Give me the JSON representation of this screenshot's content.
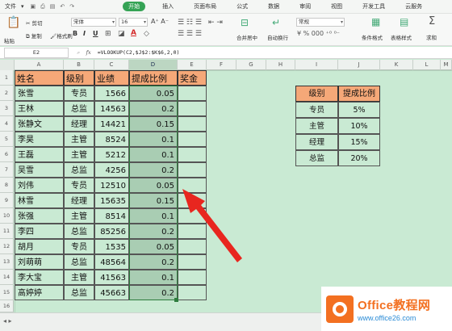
{
  "menu": {
    "file": "文件",
    "tabs": [
      "开始",
      "插入",
      "页面布局",
      "公式",
      "数据",
      "审阅",
      "视图",
      "开发工具",
      "云服务"
    ],
    "active_tab": "开始"
  },
  "ribbon": {
    "paste": "粘贴",
    "cut": "剪切",
    "copy": "复制",
    "format_painter": "格式刷",
    "font_name": "宋体",
    "font_size": "16",
    "merge_center": "合并居中",
    "auto_wrap": "自动换行",
    "number_format": "常规",
    "cond_format": "条件格式",
    "table_style": "表格样式",
    "sum": "求和",
    "font_buttons": [
      "B",
      "I",
      "U"
    ],
    "font_color_letter": "A",
    "percent_symbol": "%",
    "thousands": "000",
    "currency_symbol": "¥",
    "sum_symbol": "Σ"
  },
  "formula_bar": {
    "name_box": "E2",
    "formula": "=VLOOKUP(C2,$J$2:$K$6,2,0)",
    "icons": [
      "magnify-icon",
      "fx-icon"
    ]
  },
  "columns": [
    "A",
    "B",
    "C",
    "D",
    "E",
    "F",
    "G",
    "H",
    "I",
    "J",
    "K",
    "L",
    "M"
  ],
  "rows": [
    "1",
    "2",
    "3",
    "4",
    "5",
    "6",
    "7",
    "8",
    "9",
    "10",
    "11",
    "12",
    "13",
    "14",
    "15",
    "16",
    "17"
  ],
  "table": {
    "headers": [
      "姓名",
      "级别",
      "业绩",
      "提成比例",
      "奖金"
    ],
    "rows": [
      [
        "张雪",
        "专员",
        "1566",
        "0.05",
        ""
      ],
      [
        "王林",
        "总监",
        "14563",
        "0.2",
        ""
      ],
      [
        "张静文",
        "经理",
        "14421",
        "0.15",
        ""
      ],
      [
        "李昊",
        "主管",
        "8524",
        "0.1",
        ""
      ],
      [
        "王磊",
        "主管",
        "5212",
        "0.1",
        ""
      ],
      [
        "吴雪",
        "总监",
        "4256",
        "0.2",
        ""
      ],
      [
        "刘伟",
        "专员",
        "12510",
        "0.05",
        ""
      ],
      [
        "林雪",
        "经理",
        "15635",
        "0.15",
        ""
      ],
      [
        "张强",
        "主管",
        "8514",
        "0.1",
        ""
      ],
      [
        "李四",
        "总监",
        "85256",
        "0.2",
        ""
      ],
      [
        "胡月",
        "专员",
        "1535",
        "0.05",
        ""
      ],
      [
        "刘萌萌",
        "总监",
        "48564",
        "0.2",
        ""
      ],
      [
        "李大宝",
        "主管",
        "41563",
        "0.1",
        ""
      ],
      [
        "高婷婷",
        "总监",
        "45663",
        "0.2",
        ""
      ]
    ]
  },
  "lookup": {
    "headers": [
      "级别",
      "提成比例"
    ],
    "rows": [
      [
        "专员",
        "5%"
      ],
      [
        "主管",
        "10%"
      ],
      [
        "经理",
        "15%"
      ],
      [
        "总监",
        "20%"
      ]
    ]
  },
  "watermark": {
    "brand": "Office教程网",
    "url": "www.office26.com"
  },
  "colors": {
    "accent_green": "#35a355",
    "header_orange": "#f5a878",
    "sheet_bg": "#c9ead3",
    "arrow_red": "#e8261f",
    "logo_orange": "#f37021"
  }
}
